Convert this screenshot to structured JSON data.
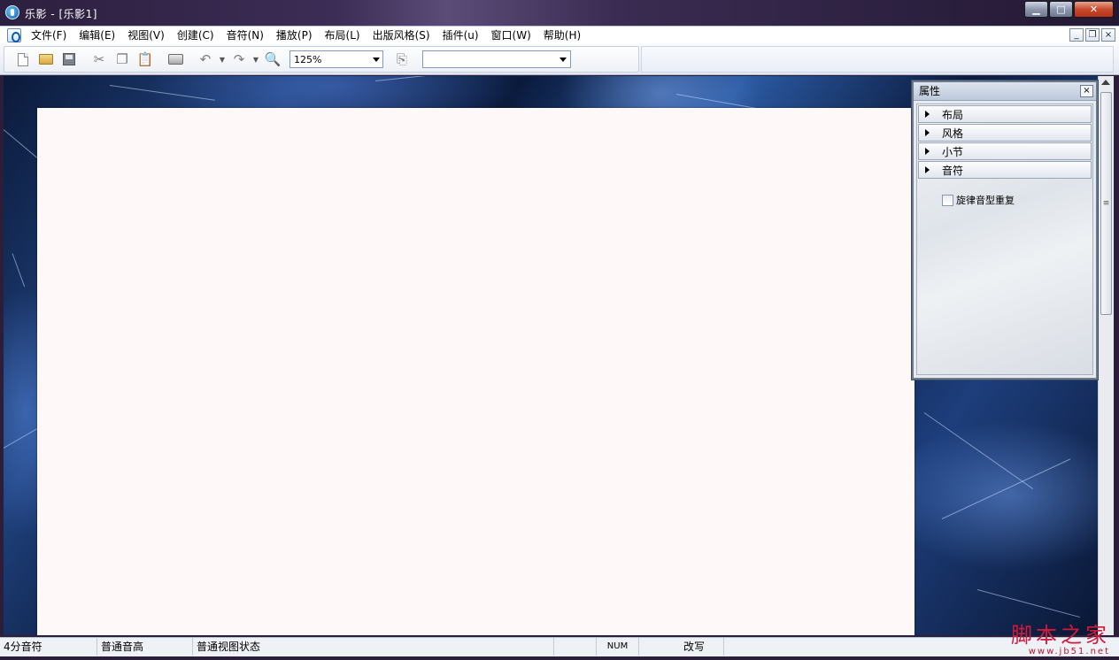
{
  "window": {
    "title": "乐影 - [乐影1]",
    "controls": {
      "minimize": "▁",
      "maximize": "□",
      "close": "✕"
    }
  },
  "menu": {
    "items": [
      "文件(F)",
      "编辑(E)",
      "视图(V)",
      "创建(C)",
      "音符(N)",
      "播放(P)",
      "布局(L)",
      "出版风格(S)",
      "插件(u)",
      "窗口(W)",
      "帮助(H)"
    ],
    "mdi_controls": {
      "minimize": "_",
      "restore": "❐",
      "close": "×"
    }
  },
  "toolbar": {
    "zoom_value": "125%",
    "font_value": ""
  },
  "properties": {
    "title": "属性",
    "close": "×",
    "sections": [
      "布局",
      "风格",
      "小节",
      "音符"
    ],
    "checkbox_label": "旋律音型重复",
    "checkbox_checked": false
  },
  "scrollbar": {
    "thumb_grip": "≡"
  },
  "status": {
    "cells": [
      "4分音符",
      "普通音高",
      "普通视图状态",
      "",
      "NUM",
      "改写"
    ]
  },
  "watermark": {
    "main": "脚本之家",
    "url": "www.jb51.net"
  },
  "colors": {
    "title_bar": "#2c1f3f",
    "close_button": "#c74a2c",
    "page_background": "#fff8f8",
    "workspace_marble": "#0c1f44",
    "watermark": "#d21a3c"
  }
}
